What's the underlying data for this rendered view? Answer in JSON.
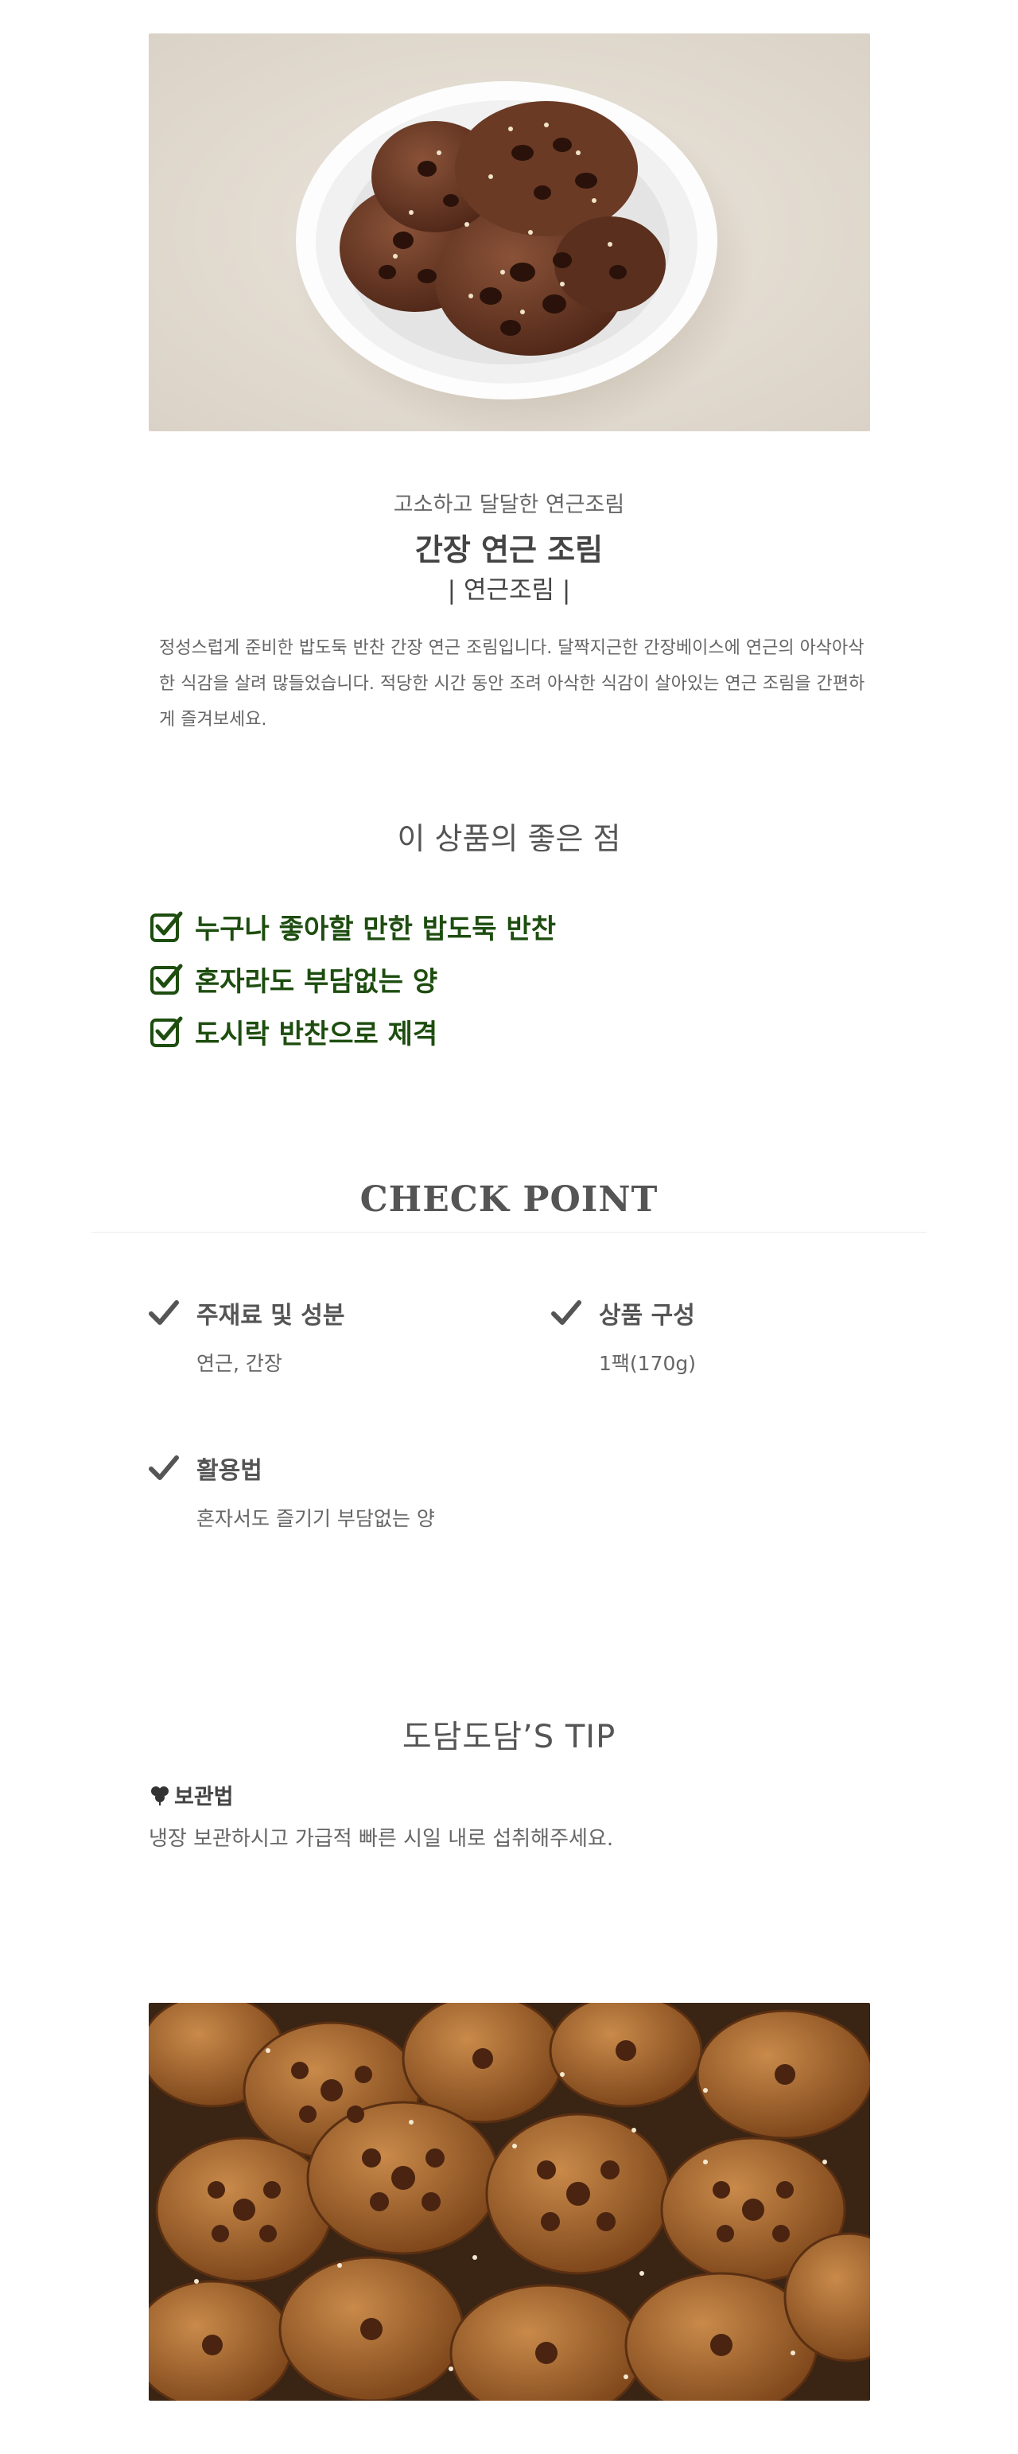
{
  "intro": {
    "subtitle": "고소하고 달달한 연근조림",
    "title": "간장 연근 조림",
    "category": "| 연근조림 |",
    "description": "정성스럽게 준비한 밥도둑 반찬 간장 연근 조림입니다. 달짝지근한 간장베이스에 연근의 아삭아삭한 식감을 살려 많들었습니다. 적당한 시간 동안 조려 아삭한 식감이 살아있는 연근 조림을 간편하게 즐겨보세요."
  },
  "good_points": {
    "heading": "이 상품의 좋은 점",
    "items": [
      {
        "label": "누구나 좋아할 만한 밥도둑 반찬"
      },
      {
        "label": "혼자라도 부담없는 양"
      },
      {
        "label": "도시락 반찬으로 제격"
      }
    ],
    "check_color": "#1d4d0f"
  },
  "check_point": {
    "heading": "CHECK POINT",
    "items": [
      {
        "title": "주재료 및 성분",
        "value": "연근, 간장"
      },
      {
        "title": "상품 구성",
        "value": "1팩(170g)"
      },
      {
        "title": "활용법",
        "value": "혼자서도 즐기기 부담없는 양"
      }
    ]
  },
  "tip": {
    "heading": "도담도담’S TIP",
    "storage_title": "보관법",
    "storage_text": "냉장 보관하시고 가급적 빠른 시일 내로 섭취해주세요.",
    "icon": "clover-icon"
  },
  "photos": {
    "hero": "braised-lotus-root-bowl-photo",
    "bottom": "braised-lotus-root-closeup-photo"
  }
}
